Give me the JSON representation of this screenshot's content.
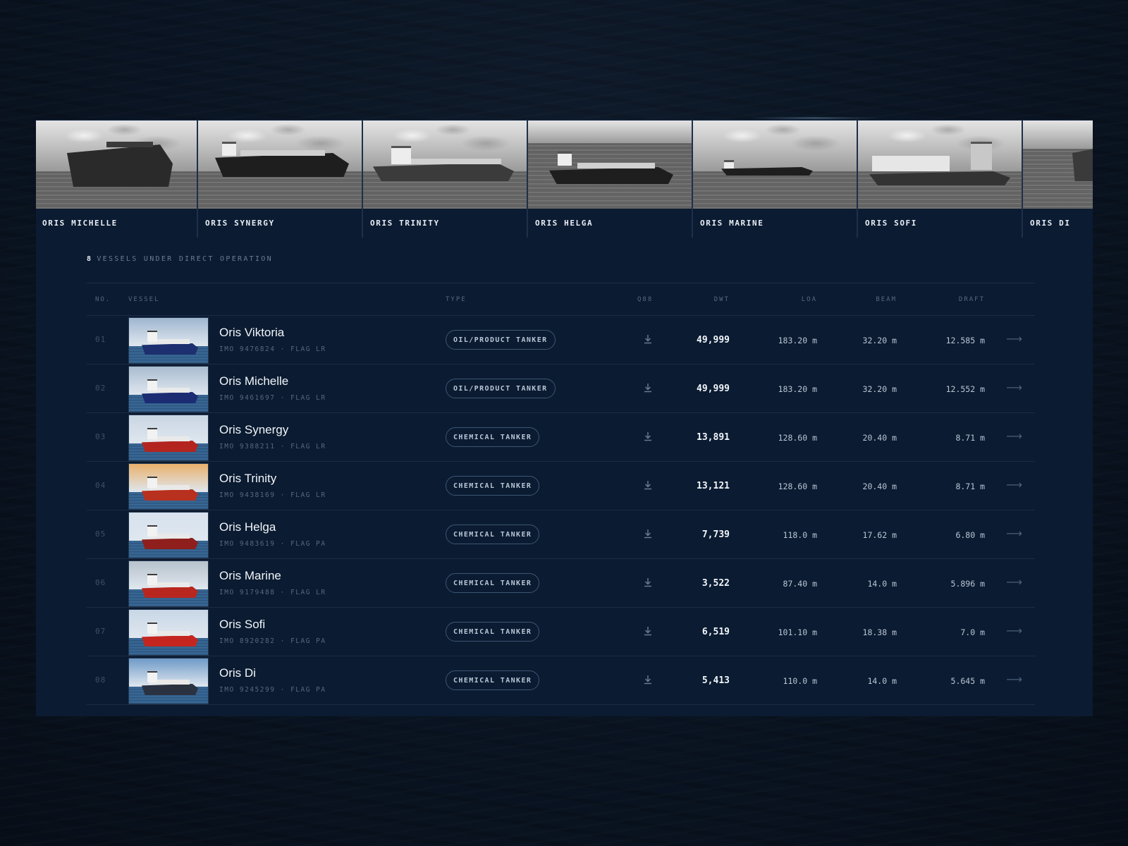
{
  "gallery": [
    {
      "label": "ORIS MICHELLE"
    },
    {
      "label": "ORIS SYNERGY"
    },
    {
      "label": "ORIS TRINITY"
    },
    {
      "label": "ORIS HELGA"
    },
    {
      "label": "ORIS MARINE"
    },
    {
      "label": "ORIS SOFI"
    },
    {
      "label": "ORIS DI"
    }
  ],
  "summary": {
    "count": "8",
    "text": "VESSELS UNDER DIRECT OPERATION"
  },
  "columns": {
    "no": "NO.",
    "vessel": "VESSEL",
    "type": "TYPE",
    "q88": "Q88",
    "dwt": "DWT",
    "loa": "LOA",
    "beam": "BEAM",
    "draft": "DRAFT"
  },
  "vessels": [
    {
      "no": "01",
      "name": "Oris Viktoria",
      "meta": "IMO 9476824 · FLAG LR",
      "type": "OIL/PRODUCT TANKER",
      "dwt": "49,999",
      "loa": "183.20 m",
      "beam": "32.20 m",
      "draft": "12.585 m",
      "hull_color": "#1d2f6e"
    },
    {
      "no": "02",
      "name": "Oris Michelle",
      "meta": "IMO 9461697 · FLAG LR",
      "type": "OIL/PRODUCT TANKER",
      "dwt": "49,999",
      "loa": "183.20 m",
      "beam": "32.20 m",
      "draft": "12.552 m",
      "hull_color": "#1b2c73"
    },
    {
      "no": "03",
      "name": "Oris Synergy",
      "meta": "IMO 9388211 · FLAG LR",
      "type": "CHEMICAL TANKER",
      "dwt": "13,891",
      "loa": "128.60 m",
      "beam": "20.40 m",
      "draft": "8.71 m",
      "hull_color": "#b3241f"
    },
    {
      "no": "04",
      "name": "Oris Trinity",
      "meta": "IMO 9438169 · FLAG LR",
      "type": "CHEMICAL TANKER",
      "dwt": "13,121",
      "loa": "128.60 m",
      "beam": "20.40 m",
      "draft": "8.71 m",
      "hull_color": "#b8301e"
    },
    {
      "no": "05",
      "name": "Oris Helga",
      "meta": "IMO 9483619 · FLAG PA",
      "type": "CHEMICAL TANKER",
      "dwt": "7,739",
      "loa": "118.0 m",
      "beam": "17.62 m",
      "draft": "6.80 m",
      "hull_color": "#8e1f1c"
    },
    {
      "no": "06",
      "name": "Oris Marine",
      "meta": "IMO 9179488 · FLAG LR",
      "type": "CHEMICAL TANKER",
      "dwt": "3,522",
      "loa": "87.40 m",
      "beam": "14.0 m",
      "draft": "5.896 m",
      "hull_color": "#b8271f"
    },
    {
      "no": "07",
      "name": "Oris Sofi",
      "meta": "IMO 8920282 · FLAG PA",
      "type": "CHEMICAL TANKER",
      "dwt": "6,519",
      "loa": "101.10 m",
      "beam": "18.38 m",
      "draft": "7.0 m",
      "hull_color": "#c4261f"
    },
    {
      "no": "08",
      "name": "Oris Di",
      "meta": "IMO 9245299 · FLAG PA",
      "type": "CHEMICAL TANKER",
      "dwt": "5,413",
      "loa": "110.0 m",
      "beam": "14.0 m",
      "draft": "5.645 m",
      "hull_color": "#2a3140"
    }
  ],
  "icons": {
    "download": "download-icon",
    "row_arrow": "arrow-right-icon"
  }
}
